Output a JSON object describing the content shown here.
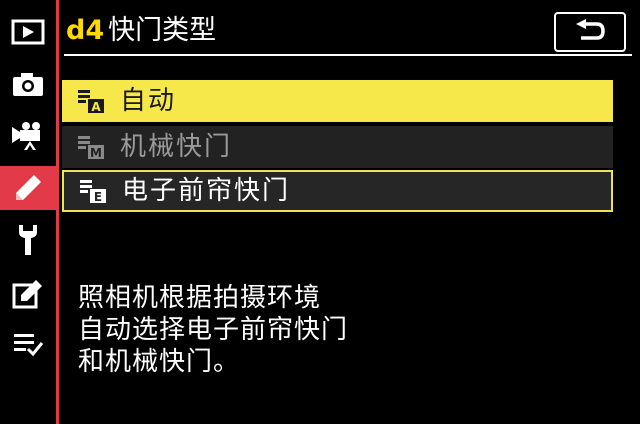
{
  "header": {
    "code": "d4",
    "title": "快门类型"
  },
  "sidebar": {
    "items": [
      {
        "name": "playback-icon"
      },
      {
        "name": "camera-icon"
      },
      {
        "name": "movie-camera-icon"
      },
      {
        "name": "pencil-icon",
        "active": true
      },
      {
        "name": "wrench-icon"
      },
      {
        "name": "retouch-icon"
      },
      {
        "name": "my-menu-icon"
      }
    ]
  },
  "menu": {
    "items": [
      {
        "icon": "auto-shutter-icon",
        "badge": "A",
        "label": "自动",
        "state": "highlighted"
      },
      {
        "icon": "mechanical-shutter-icon",
        "badge": "M",
        "label": "机械快门",
        "state": "disabled"
      },
      {
        "icon": "electronic-shutter-icon",
        "badge": "E",
        "label": "电子前帘快门",
        "state": "selected"
      }
    ]
  },
  "help": {
    "lines": [
      "照相机根据拍摄环境",
      "自动选择电子前帘快门",
      "和机械快门。"
    ]
  },
  "colors": {
    "accent": "#e23a48",
    "highlight": "#f6e84a",
    "code": "#ffd900"
  }
}
